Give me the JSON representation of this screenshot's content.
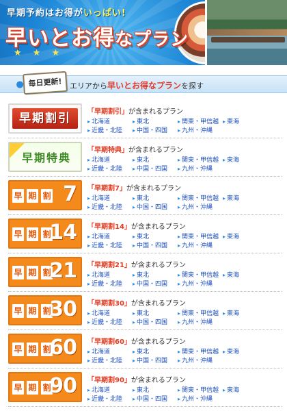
{
  "hero": {
    "eyebrow_prefix": "早期予約はお得が",
    "eyebrow_accent": "いっぱい!",
    "title_main": "早いとお得",
    "title_tail": "なプラン"
  },
  "section": {
    "badge": "毎日更新!",
    "text_prefix": "エリアから",
    "text_highlight": "早いとお得なプラン",
    "text_suffix": "を探す"
  },
  "regions": [
    "北海道",
    "東北",
    "関東・甲信越",
    "東海",
    "近畿・北陸",
    "中国・四国",
    "九州・沖縄"
  ],
  "plans": [
    {
      "banner_type": "red",
      "banner_text": "早期割引",
      "keyword": "「早期割引」",
      "suffix": "が含まれるプラン"
    },
    {
      "banner_type": "green",
      "banner_text": "早期特典",
      "keyword": "「早期特典」",
      "suffix": "が含まれるプラン"
    },
    {
      "banner_type": "orange",
      "banner_kanji": [
        "早",
        "期",
        "割"
      ],
      "banner_number": "7",
      "keyword": "「早期割7」",
      "suffix": "が含まれるプラン"
    },
    {
      "banner_type": "orange",
      "banner_kanji": [
        "早",
        "期",
        "割"
      ],
      "banner_number": "14",
      "keyword": "「早期割14」",
      "suffix": "が含まれるプラン"
    },
    {
      "banner_type": "orange",
      "banner_kanji": [
        "早",
        "期",
        "割"
      ],
      "banner_number": "21",
      "keyword": "「早期割21」",
      "suffix": "が含まれるプラン"
    },
    {
      "banner_type": "orange",
      "banner_kanji": [
        "早",
        "期",
        "割"
      ],
      "banner_number": "30",
      "keyword": "「早期割30」",
      "suffix": "が含まれるプラン"
    },
    {
      "banner_type": "orange",
      "banner_kanji": [
        "早",
        "期",
        "割"
      ],
      "banner_number": "60",
      "keyword": "「早期割60」",
      "suffix": "が含まれるプラン"
    },
    {
      "banner_type": "orange",
      "banner_kanji": [
        "早",
        "期",
        "割"
      ],
      "banner_number": "90",
      "keyword": "「早期割90」",
      "suffix": "が含まれるプラン"
    }
  ],
  "colors": {
    "hero_blue": "#1d86d6",
    "accent_red": "#e23b21",
    "banner_orange": "#f58a1c",
    "banner_green": "#3a8a1f",
    "link_blue": "#1d4fbf"
  }
}
